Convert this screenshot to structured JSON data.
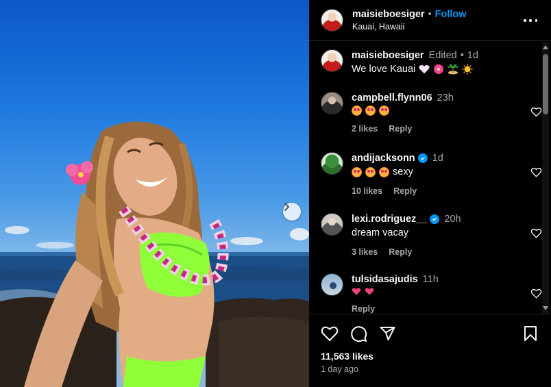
{
  "post": {
    "username": "maisieboesiger",
    "follow_label": "Follow",
    "separator": "•",
    "location": "Kauai, Hawaii",
    "caption_text": "We love Kauai",
    "caption_edited": "Edited",
    "caption_time": "1d"
  },
  "comments": [
    {
      "username": "campbell.flynn06",
      "time": "23h",
      "text": "",
      "emojis": [
        "heart-eyes-emoji",
        "heart-eyes-emoji",
        "heart-eyes-emoji"
      ],
      "likes": "2 likes",
      "reply": "Reply",
      "verified": false
    },
    {
      "username": "andijacksonn",
      "time": "1d",
      "text": "sexy",
      "emojis": [
        "heart-eyes-emoji",
        "heart-eyes-emoji",
        "heart-eyes-emoji"
      ],
      "likes": "10 likes",
      "reply": "Reply",
      "verified": true
    },
    {
      "username": "lexi.rodriguez__",
      "time": "20h",
      "text": "dream vacay",
      "emojis": [],
      "likes": "3 likes",
      "reply": "Reply",
      "verified": true
    },
    {
      "username": "tulsidasajudis",
      "time": "11h",
      "text": "",
      "emojis": [
        "red-heart-emoji",
        "red-heart-emoji"
      ],
      "likes": "",
      "reply": "Reply",
      "verified": false
    }
  ],
  "footer": {
    "likes_count": "11,563 likes",
    "posted_ago": "1 day ago"
  },
  "icons": {
    "like": "heart-icon",
    "comment": "comment-icon",
    "share": "share-icon",
    "save": "bookmark-icon",
    "more": "more-options-icon",
    "next": "chevron-right-icon"
  },
  "colors": {
    "accent": "#0095f6",
    "background": "#000000",
    "muted_text": "#a8a8a8"
  }
}
